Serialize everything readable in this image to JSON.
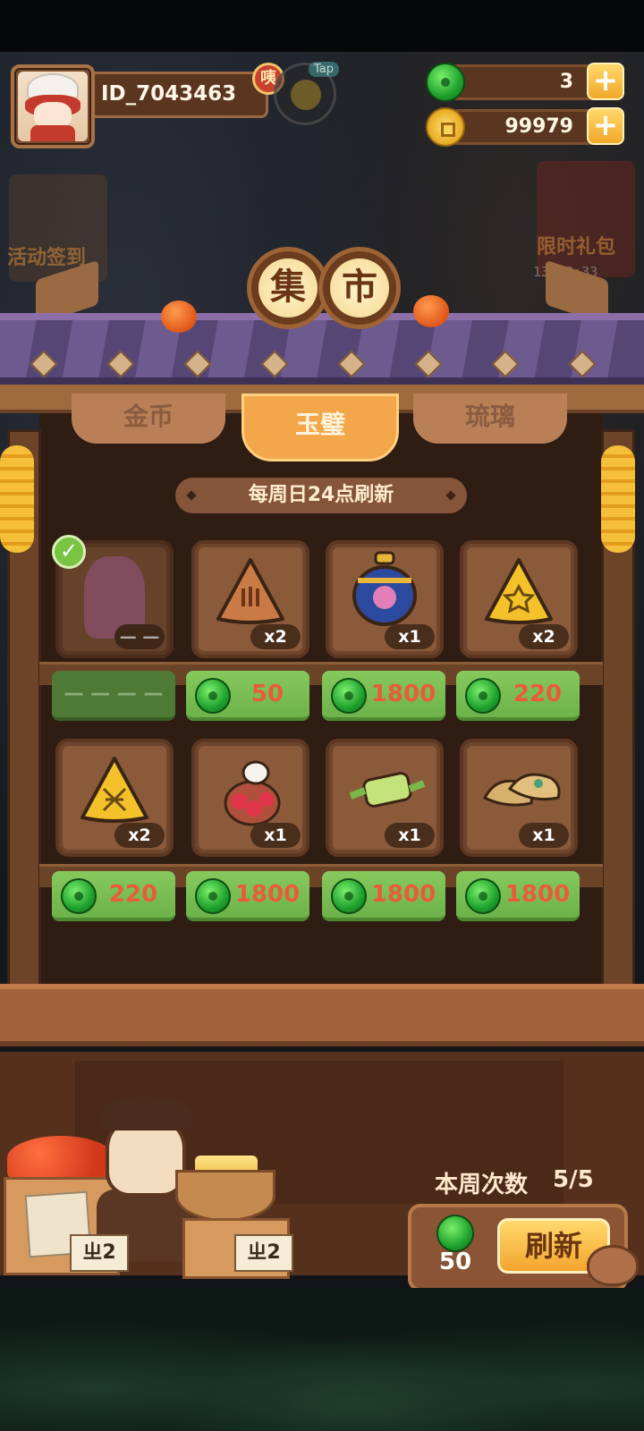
{
  "player": {
    "id": "ID_7043463",
    "title_badge": "咦",
    "tap_label": "Tap"
  },
  "currency": {
    "jade": "3",
    "coins": "99979"
  },
  "background": {
    "event_signin_label": "活动签到",
    "limited_gift_label": "限时礼包",
    "gift_timer": "13:53:33"
  },
  "market": {
    "sign_chars": [
      "集",
      "市"
    ],
    "tabs": [
      "金币",
      "玉璧",
      "琉璃"
    ],
    "active_tab": "玉璧",
    "refresh_note": "每周日24点刷新",
    "items": [
      {
        "count": "— —",
        "price": "— — — —",
        "owned": true
      },
      {
        "count": "x2",
        "price": "50"
      },
      {
        "count": "x1",
        "price": "1800"
      },
      {
        "count": "x2",
        "price": "220"
      },
      {
        "count": "x2",
        "price": "220"
      },
      {
        "count": "x1",
        "price": "1800"
      },
      {
        "count": "x1",
        "price": "1800"
      },
      {
        "count": "x1",
        "price": "1800"
      }
    ]
  },
  "refresh": {
    "weekly_label": "本周次数",
    "weekly_count": "5/5",
    "cost": "50",
    "button_label": "刷新"
  },
  "vendor": {
    "tag_left": "ㄓ2",
    "tag_right": "ㄓ2"
  },
  "colors": {
    "price_text": "#ea5b3c",
    "active_tab": "#f3a74a",
    "price_button": "#79bd52"
  }
}
